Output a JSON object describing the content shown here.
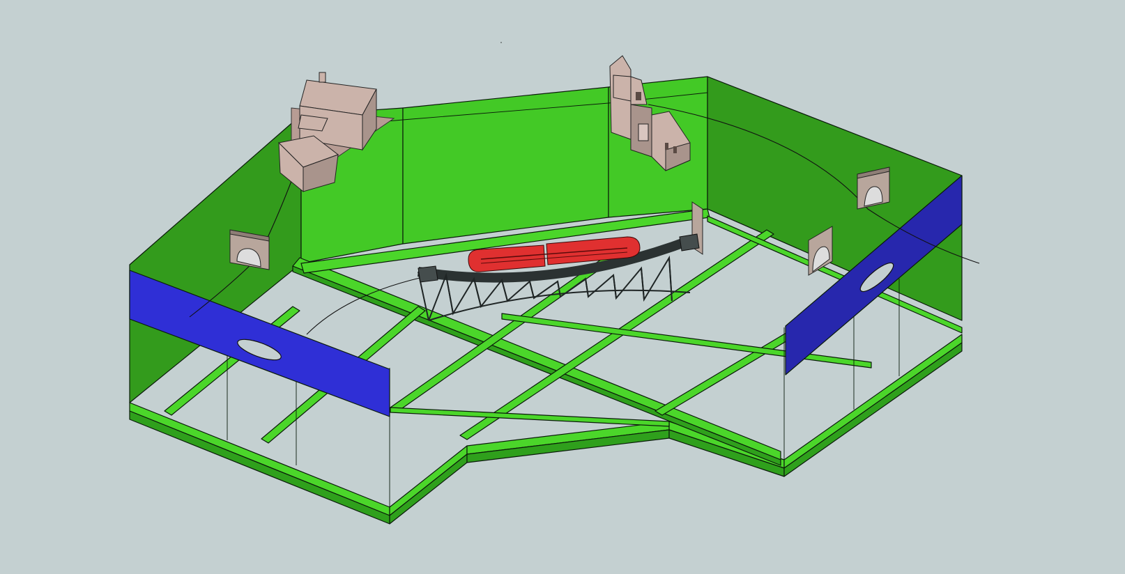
{
  "scene": {
    "kind": "3d-model-viewport",
    "objects": [
      "baseboard-frame",
      "backdrop-wall",
      "fascia-left",
      "fascia-right",
      "farmhouse",
      "church",
      "truss-bridge",
      "train",
      "tunnel-portals"
    ]
  },
  "colors": {
    "background": "#c4d0d1",
    "frame_green": "#43c926",
    "frame_green_dark": "#2fa01c",
    "fascia_blue": "#2f2fd6",
    "train_red": "#e03030",
    "bridge_gray": "#1f2525",
    "building_beige": "#cbb3aa"
  }
}
